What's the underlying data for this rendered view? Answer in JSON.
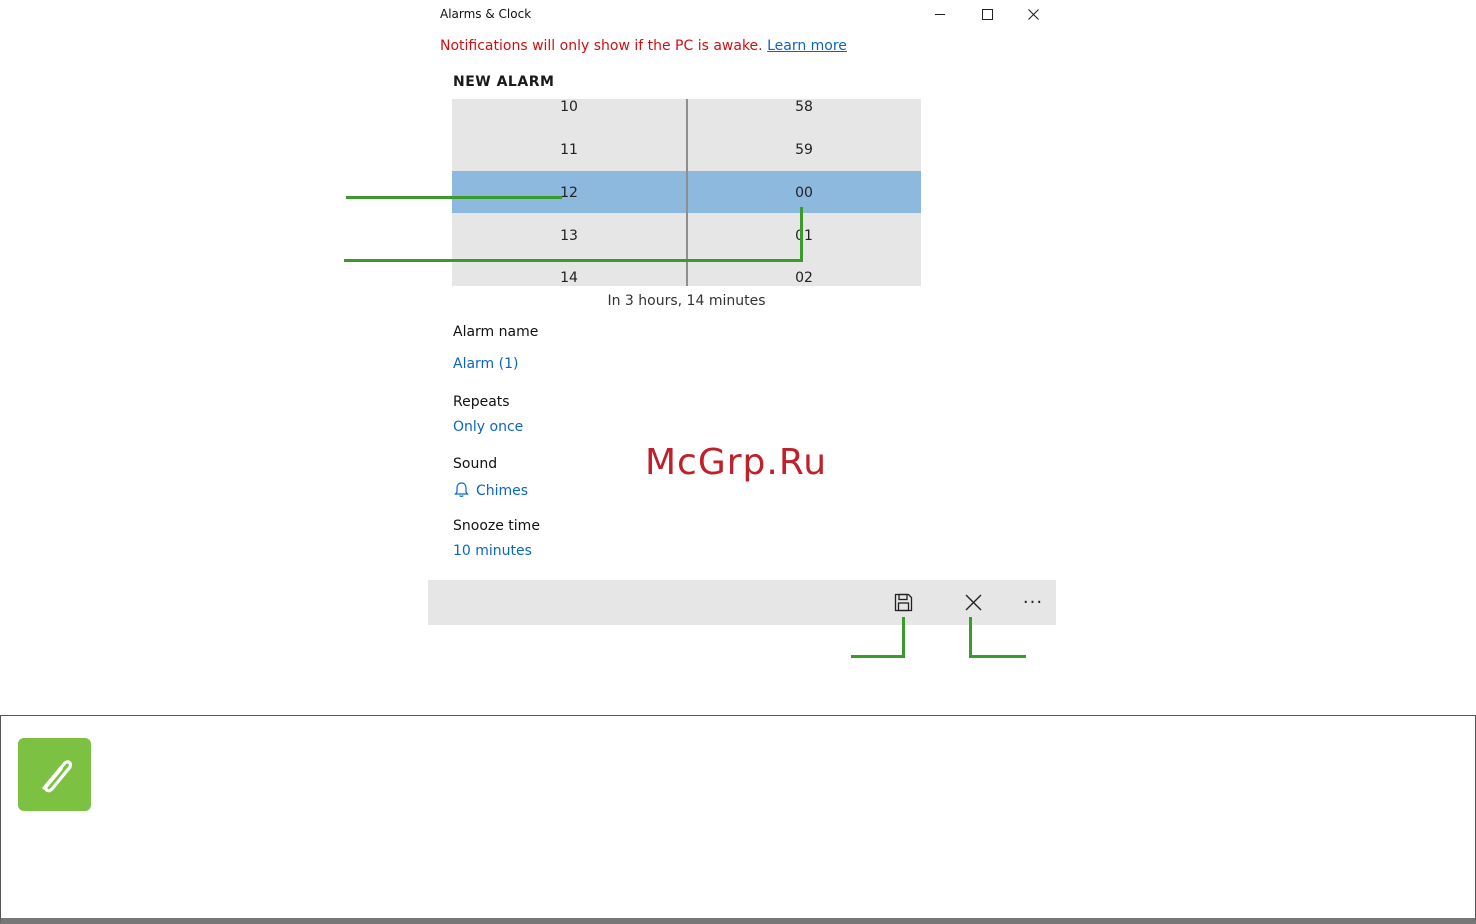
{
  "window": {
    "title": "Alarms & Clock"
  },
  "notice": {
    "text": "Notifications will only show if the PC is awake. ",
    "link": "Learn more"
  },
  "heading": "NEW ALARM",
  "picker": {
    "hours": [
      "10",
      "11",
      "12",
      "13",
      "14"
    ],
    "minutes": [
      "58",
      "59",
      "00",
      "01",
      "02"
    ],
    "selected_hour": "12",
    "selected_minute": "00",
    "caption": "In 3 hours, 14 minutes"
  },
  "fields": {
    "name_label": "Alarm name",
    "name_value": "Alarm (1)",
    "repeats_label": "Repeats",
    "repeats_value": "Only once",
    "sound_label": "Sound",
    "sound_value": "Chimes",
    "snooze_label": "Snooze time",
    "snooze_value": "10 minutes"
  },
  "commandbar": {
    "save_icon": "save-icon",
    "cancel_icon": "close-icon",
    "more_label": "···"
  },
  "note": {
    "icon": "paperclip-icon"
  },
  "watermark": "McGrp.Ru",
  "colors": {
    "accent": "#0a66c2",
    "warning": "#d01010",
    "selection": "#8db9df",
    "callout": "#3a9a2b",
    "note_icon": "#7cc142"
  }
}
